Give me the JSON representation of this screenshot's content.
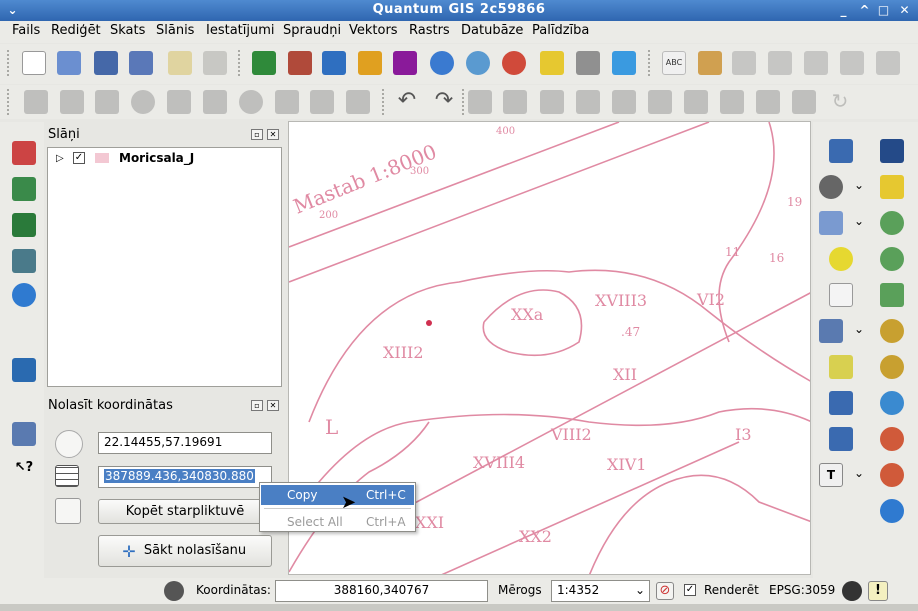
{
  "window": {
    "title": "Quantum GIS 2c59866",
    "menu_icon": "chevron-down-icon",
    "minimize": "_",
    "maximize": "□",
    "close": "✕"
  },
  "menubar": [
    "Fails",
    "Rediģēt",
    "Skats",
    "Slānis",
    "Iestatījumi",
    "Spraudņi",
    "Vektors",
    "Rastrs",
    "Datubāze",
    "Palīdzība"
  ],
  "layers_panel": {
    "title": "Slāņi",
    "layer_name": "Moricsala_J",
    "layer_checked": true
  },
  "coord_panel": {
    "title": "Nolasīt koordinātas",
    "geo_value": "22.14455,57.19691",
    "proj_value": "387889.436,340830.880",
    "copy_button": "Kopēt starpliktuvē",
    "start_button": "Sākt nolasīšanu"
  },
  "context_menu": {
    "items": [
      {
        "label": "Copy",
        "shortcut": "Ctrl+C",
        "enabled": true
      },
      {
        "label": "Select All",
        "shortcut": "Ctrl+A",
        "enabled": false
      }
    ]
  },
  "map": {
    "scale_text": "Mastab 1:8000",
    "labels": [
      "400",
      "300",
      "200",
      "XXa",
      "XVIII3",
      "VI2",
      "XIII2",
      "XII",
      "VIII2",
      "XIV1",
      "XVIII4",
      "XXI",
      "XX2",
      "I3",
      "19",
      "16",
      "11",
      ".47",
      "L"
    ],
    "line_color": "#e08aa3"
  },
  "statusbar": {
    "coord_label": "Koordinātas:",
    "coord_value": "388160,340767",
    "scale_label": "Mērogs",
    "scale_value": "1:4352",
    "render_label": "Renderēt",
    "render_checked": true,
    "crs": "EPSG:3059"
  },
  "colors": {
    "titlebar": "#3a74c0",
    "selection": "#4a7fc4",
    "accent_green": "#2ea02e"
  }
}
